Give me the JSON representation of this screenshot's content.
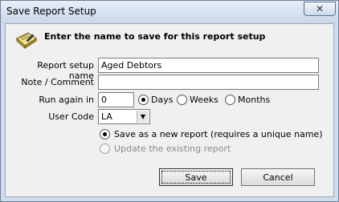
{
  "window": {
    "title": "Save Report Setup",
    "close_glyph": "✕"
  },
  "header": {
    "text": "Enter the name to save for this report setup",
    "icon": "notebook-pencil-icon"
  },
  "form": {
    "report_setup_name_label": "Report setup name",
    "report_setup_name_value": "Aged Debtors",
    "note_label": "Note / Comment",
    "note_value": "",
    "run_again_label": "Run again in",
    "run_again_value": "0",
    "units": [
      {
        "label": "Days",
        "selected": true
      },
      {
        "label": "Weeks",
        "selected": false
      },
      {
        "label": "Months",
        "selected": false
      }
    ],
    "user_code_label": "User Code",
    "user_code_value": "LA",
    "save_options": [
      {
        "label": "Save as a new report (requires a unique name)",
        "selected": true,
        "enabled": true
      },
      {
        "label": "Update the existing report",
        "selected": false,
        "enabled": false
      }
    ]
  },
  "buttons": {
    "save": "Save",
    "cancel": "Cancel"
  }
}
